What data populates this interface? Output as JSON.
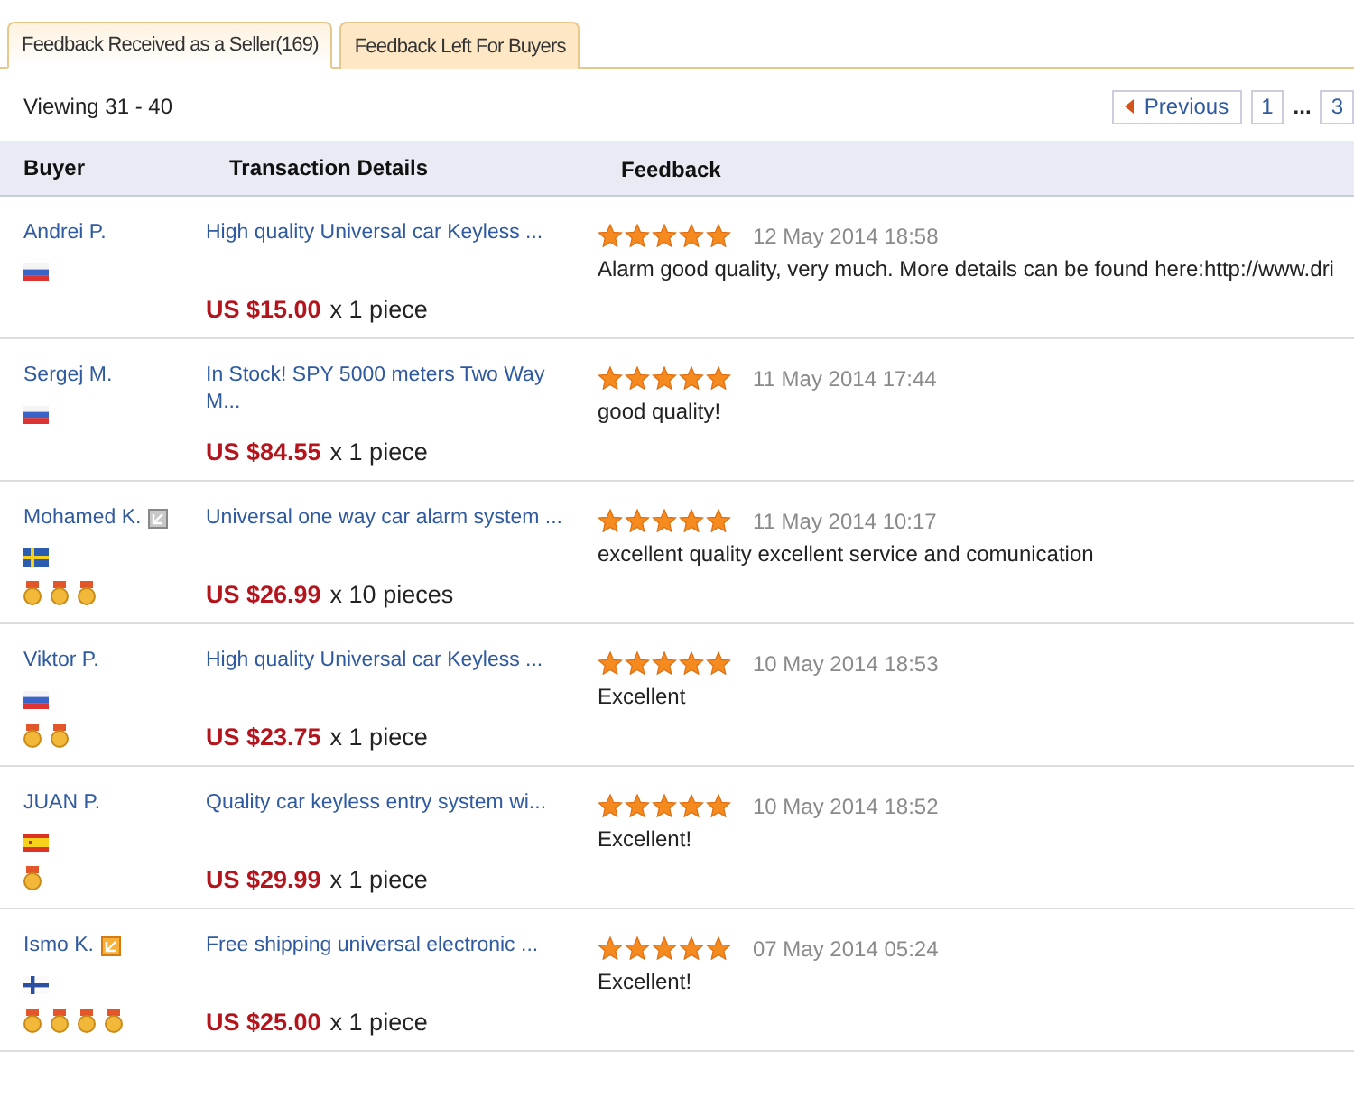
{
  "tabs": [
    {
      "label": "Feedback Received as a Seller(169)",
      "selected": true
    },
    {
      "label": "Feedback Left For Buyers",
      "selected": false
    }
  ],
  "viewing": "Viewing 31 - 40",
  "pagination": {
    "previous": "Previous",
    "pages": [
      {
        "label": "1",
        "kind": "page"
      },
      {
        "label": "...",
        "kind": "gap"
      },
      {
        "label": "3",
        "kind": "page"
      }
    ]
  },
  "table": {
    "columns": [
      "Buyer",
      "Transaction Details",
      "Feedback"
    ],
    "rows": [
      {
        "buyer": "Andrei P.",
        "flag": {
          "kind": "russia"
        },
        "product": "High quality Universal car Keyless ...",
        "price": "US $15.00",
        "quantity": "x 1 piece",
        "stars": 5,
        "date": "12 May 2014 18:58",
        "comment": "Alarm good quality, very much. More details can be found here:http://www.dri"
      },
      {
        "buyer": "Sergej M.",
        "flag": {
          "kind": "russia"
        },
        "product": "In Stock! SPY 5000 meters Two Way M...",
        "price": "US $84.55",
        "quantity": "x 1 piece",
        "stars": 5,
        "date": "11 May 2014 17:44",
        "comment": "good quality!"
      },
      {
        "buyer": "Mohamed K.",
        "badge": {
          "kind": "grey"
        },
        "flag": {
          "kind": "sweden"
        },
        "medals": [
          {
            "kind": "medal"
          },
          {
            "kind": "medal"
          },
          {
            "kind": "medal"
          }
        ],
        "product": "Universal one way car alarm system ...",
        "price": "US $26.99",
        "quantity": "x 10 pieces",
        "stars": 5,
        "date": "11 May 2014 10:17",
        "comment": "excellent quality excellent service and comunication"
      },
      {
        "buyer": "Viktor P.",
        "flag": {
          "kind": "russia"
        },
        "medals": [
          {
            "kind": "medal"
          },
          {
            "kind": "medal"
          }
        ],
        "product": "High quality Universal car Keyless ...",
        "price": "US $23.75",
        "quantity": "x 1 piece",
        "stars": 5,
        "date": "10 May 2014 18:53",
        "comment": "Excellent"
      },
      {
        "buyer": "JUAN P.",
        "flag": {
          "kind": "spain"
        },
        "medals": [
          {
            "kind": "medal"
          }
        ],
        "product": "Quality car keyless entry system wi...",
        "price": "US $29.99",
        "quantity": "x 1 piece",
        "stars": 5,
        "date": "10 May 2014 18:52",
        "comment": "Excellent!"
      },
      {
        "buyer": "Ismo K.",
        "badge": {
          "kind": "orange"
        },
        "flag": {
          "kind": "finland"
        },
        "medals": [
          {
            "kind": "medal"
          },
          {
            "kind": "medal"
          },
          {
            "kind": "medal"
          },
          {
            "kind": "medal"
          }
        ],
        "product": "Free shipping universal electronic ...",
        "price": "US $25.00",
        "quantity": "x 1 piece",
        "stars": 5,
        "date": "07 May 2014 05:24",
        "comment": "Excellent!"
      }
    ]
  }
}
